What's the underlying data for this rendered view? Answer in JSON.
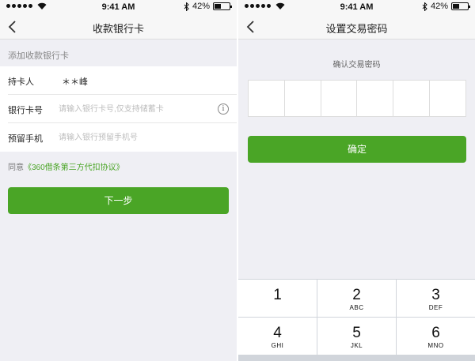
{
  "left": {
    "status": {
      "time": "9:41 AM",
      "battery": "42%",
      "battery_level": 0.42
    },
    "nav": {
      "title": "收款银行卡"
    },
    "section_header": "添加收款银行卡",
    "form": {
      "holder_label": "持卡人",
      "holder_value": "＊＊峰",
      "card_label": "银行卡号",
      "card_placeholder": "请输入银行卡号,仅支持储蓄卡",
      "phone_label": "预留手机",
      "phone_placeholder": "请输入银行预留手机号"
    },
    "agree_prefix": "同意",
    "agree_link": "《360借条第三方代扣协议》",
    "next_button": "下一步"
  },
  "right": {
    "status": {
      "time": "9:41 AM",
      "battery": "42%",
      "battery_level": 0.42
    },
    "nav": {
      "title": "设置交易密码"
    },
    "confirm_label": "确认交易密码",
    "confirm_button": "确定",
    "keypad": [
      {
        "num": "1",
        "letters": ""
      },
      {
        "num": "2",
        "letters": "ABC"
      },
      {
        "num": "3",
        "letters": "DEF"
      },
      {
        "num": "4",
        "letters": "GHI"
      },
      {
        "num": "5",
        "letters": "JKL"
      },
      {
        "num": "6",
        "letters": "MNO"
      }
    ]
  },
  "colors": {
    "accent": "#4aa526",
    "background": "#efeff4"
  }
}
